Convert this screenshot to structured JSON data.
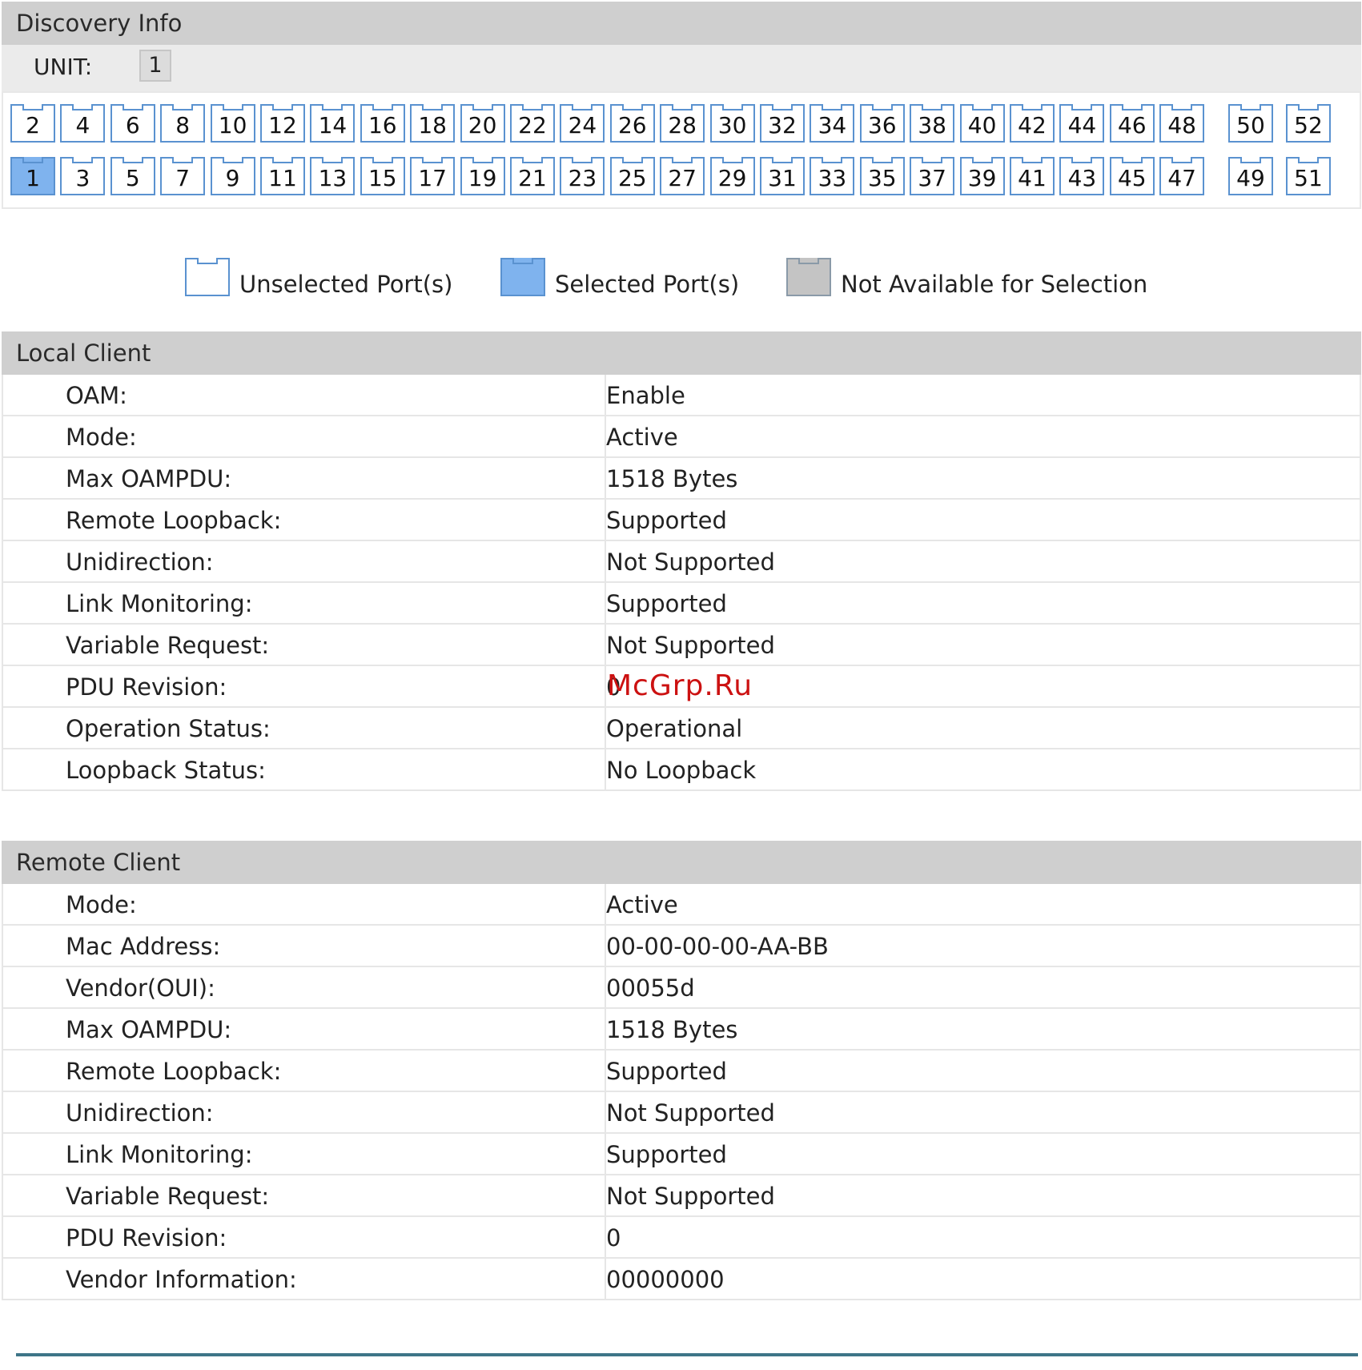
{
  "discovery": {
    "header": "Discovery Info",
    "unit_label": "UNIT:",
    "unit_value": "1",
    "top_row_ports": [
      "2",
      "4",
      "6",
      "8",
      "10",
      "12",
      "14",
      "16",
      "18",
      "20",
      "22",
      "24",
      "26",
      "28",
      "30",
      "32",
      "34",
      "36",
      "38",
      "40",
      "42",
      "44",
      "46",
      "48",
      "50",
      "52"
    ],
    "bottom_row_ports": [
      "1",
      "3",
      "5",
      "7",
      "9",
      "11",
      "13",
      "15",
      "17",
      "19",
      "21",
      "23",
      "25",
      "27",
      "29",
      "31",
      "33",
      "35",
      "37",
      "39",
      "41",
      "43",
      "45",
      "47",
      "49",
      "51"
    ],
    "selected_port": "1"
  },
  "legend": {
    "unselected": "Unselected Port(s)",
    "selected": "Selected Port(s)",
    "not_available": "Not Available for Selection"
  },
  "local_client": {
    "header": "Local Client",
    "rows": [
      {
        "label": "OAM:",
        "value": "Enable"
      },
      {
        "label": "Mode:",
        "value": "Active"
      },
      {
        "label": "Max OAMPDU:",
        "value": "1518 Bytes"
      },
      {
        "label": "Remote Loopback:",
        "value": "Supported"
      },
      {
        "label": "Unidirection:",
        "value": "Not Supported"
      },
      {
        "label": "Link Monitoring:",
        "value": "Supported"
      },
      {
        "label": "Variable Request:",
        "value": "Not Supported"
      },
      {
        "label": "PDU Revision:",
        "value": "0"
      },
      {
        "label": "Operation Status:",
        "value": "Operational"
      },
      {
        "label": "Loopback Status:",
        "value": "No Loopback"
      }
    ]
  },
  "remote_client": {
    "header": "Remote Client",
    "rows": [
      {
        "label": "Mode:",
        "value": "Active"
      },
      {
        "label": "Mac Address:",
        "value": "00-00-00-00-AA-BB"
      },
      {
        "label": "Vendor(OUI):",
        "value": "00055d"
      },
      {
        "label": "Max OAMPDU:",
        "value": "1518 Bytes"
      },
      {
        "label": "Remote Loopback:",
        "value": "Supported"
      },
      {
        "label": "Unidirection:",
        "value": "Not Supported"
      },
      {
        "label": "Link Monitoring:",
        "value": "Supported"
      },
      {
        "label": "Variable Request:",
        "value": "Not Supported"
      },
      {
        "label": "PDU Revision:",
        "value": "0"
      },
      {
        "label": "Vendor Information:",
        "value": "00000000"
      }
    ]
  },
  "watermark": "McGrp.Ru",
  "colors": {
    "header_bg": "#cfcfcf",
    "port_border": "#5a92d0",
    "port_selected": "#7fb3ee",
    "port_unavailable": "#c4c4c4",
    "bottom_rule": "#3e7588"
  }
}
